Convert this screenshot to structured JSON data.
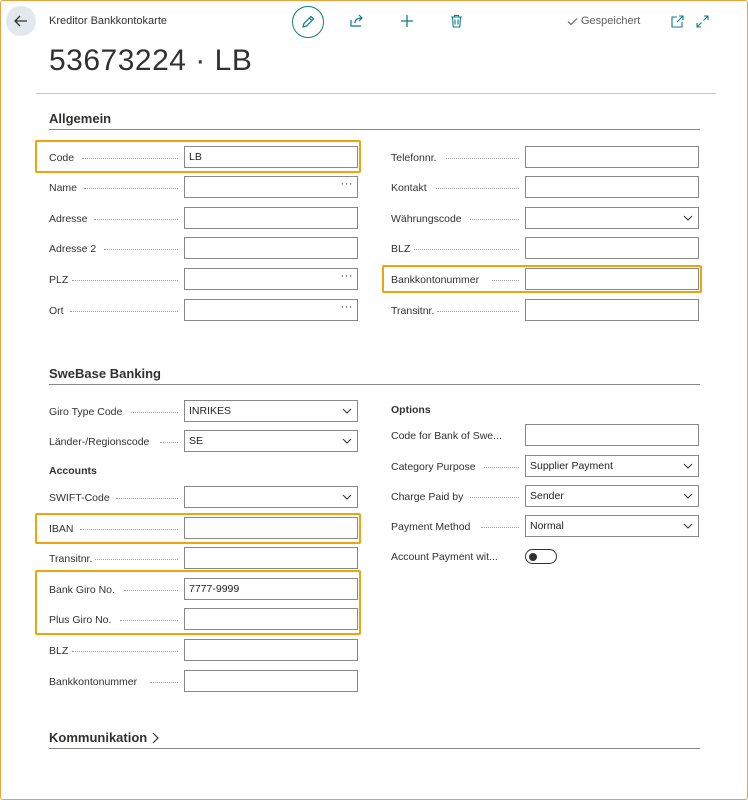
{
  "header": {
    "breadcrumb": "Kreditor Bankkontokarte",
    "title": "53673224 · LB",
    "saved_label": "Gespeichert"
  },
  "allgemein": {
    "title": "Allgemein",
    "left": [
      {
        "label": "Code",
        "value": "LB"
      },
      {
        "label": "Name",
        "value": "",
        "lookup": "···"
      },
      {
        "label": "Adresse",
        "value": ""
      },
      {
        "label": "Adresse 2",
        "value": ""
      },
      {
        "label": "PLZ",
        "value": "",
        "lookup": "···"
      },
      {
        "label": "Ort",
        "value": "",
        "lookup": "···"
      }
    ],
    "right": [
      {
        "label": "Telefonnr.",
        "value": ""
      },
      {
        "label": "Kontakt",
        "value": ""
      },
      {
        "label": "Währungscode",
        "value": ""
      },
      {
        "label": "BLZ",
        "value": ""
      },
      {
        "label": "Bankkontonummer",
        "value": ""
      },
      {
        "label": "Transitnr.",
        "value": ""
      }
    ]
  },
  "swebase": {
    "title": "SweBase Banking",
    "giro_type": {
      "label": "Giro Type Code",
      "value": "INRIKES"
    },
    "region": {
      "label": "Länder-/Regionscode",
      "value": "SE"
    },
    "accounts_title": "Accounts",
    "accounts": [
      {
        "label": "SWIFT-Code",
        "value": ""
      },
      {
        "label": "IBAN",
        "value": ""
      },
      {
        "label": "Transitnr.",
        "value": ""
      },
      {
        "label": "Bank Giro No.",
        "value": "7777-9999"
      },
      {
        "label": "Plus Giro No.",
        "value": ""
      },
      {
        "label": "BLZ",
        "value": ""
      },
      {
        "label": "Bankkontonummer",
        "value": ""
      }
    ],
    "options_title": "Options",
    "options": [
      {
        "label": "Code for Bank of Swe...",
        "value": ""
      },
      {
        "label": "Category Purpose",
        "value": "Supplier Payment"
      },
      {
        "label": "Charge Paid by",
        "value": "Sender"
      },
      {
        "label": "Payment Method",
        "value": "Normal"
      },
      {
        "label": "Account Payment wit...",
        "value": "off"
      }
    ]
  },
  "kommunikation": {
    "title": "Kommunikation"
  },
  "colors": {
    "accent": "#0f7b8a",
    "highlight": "#f0a30a"
  }
}
